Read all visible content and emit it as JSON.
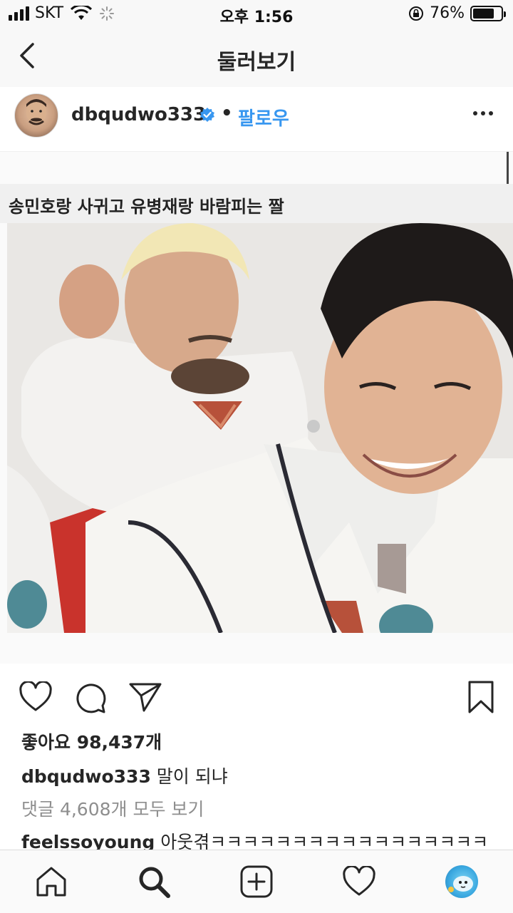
{
  "status_bar": {
    "carrier": "SKT",
    "time": "오후 1:56",
    "battery": "76%",
    "battery_level": 0.76
  },
  "nav": {
    "title": "둘러보기"
  },
  "post": {
    "username": "dbqudwo333",
    "follow_label": "팔로우",
    "separator": "•",
    "image_caption": "송민호랑 사귀고 유병재랑 바람피는 짤",
    "likes_text": "좋아요 98,437개",
    "caption_user": "dbqudwo333",
    "caption_text": "말이 되냐",
    "view_comments": "댓글 4,608개 모두 보기",
    "comment": {
      "user": "feelssoyoung",
      "text": "아웃겪ㅋㅋㅋㅋㅋㅋㅋㅋㅋㅋㅋㅋㅋㅋㅋㅋㅋ"
    }
  },
  "icons": {
    "like": "heart-icon",
    "comment": "comment-icon",
    "share": "send-icon",
    "save": "bookmark-icon",
    "home": "home-icon",
    "search": "search-icon",
    "add": "add-icon",
    "activity": "heart-icon",
    "profile": "avatar"
  },
  "colors": {
    "accent": "#3897f0",
    "text": "#262626",
    "muted": "#8e8e8e"
  }
}
